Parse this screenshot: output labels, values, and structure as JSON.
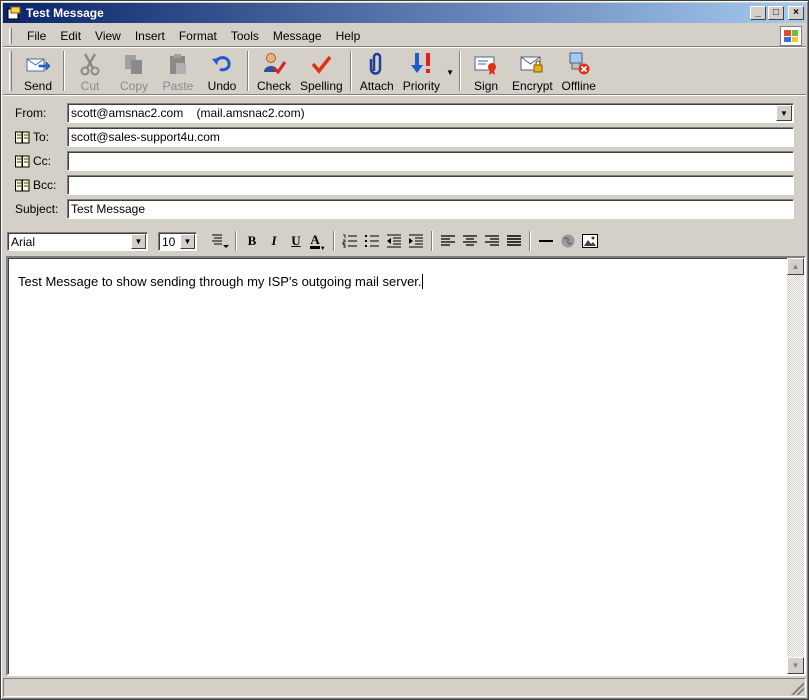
{
  "window": {
    "title": "Test Message",
    "minimize_label": "_",
    "maximize_label": "□",
    "close_label": "×"
  },
  "menu": {
    "items": [
      {
        "label": "File"
      },
      {
        "label": "Edit"
      },
      {
        "label": "View"
      },
      {
        "label": "Insert"
      },
      {
        "label": "Format"
      },
      {
        "label": "Tools"
      },
      {
        "label": "Message"
      },
      {
        "label": "Help"
      }
    ]
  },
  "toolbar": {
    "send": "Send",
    "cut": "Cut",
    "copy": "Copy",
    "paste": "Paste",
    "undo": "Undo",
    "check": "Check",
    "spelling": "Spelling",
    "attach": "Attach",
    "priority": "Priority",
    "sign": "Sign",
    "encrypt": "Encrypt",
    "offline": "Offline"
  },
  "header": {
    "from_label": "From:",
    "from_value": "scott@amsnac2.com    (mail.amsnac2.com)",
    "to_label": "To:",
    "to_value": "scott@sales-support4u.com",
    "cc_label": "Cc:",
    "cc_value": "",
    "bcc_label": "Bcc:",
    "bcc_value": "",
    "subject_label": "Subject:",
    "subject_value": "Test Message"
  },
  "format": {
    "font": "Arial",
    "size": "10",
    "bold": "B",
    "italic": "I",
    "underline": "U",
    "font_color": "A"
  },
  "body": {
    "text": "Test Message to show sending through my ISP's outgoing mail server."
  }
}
